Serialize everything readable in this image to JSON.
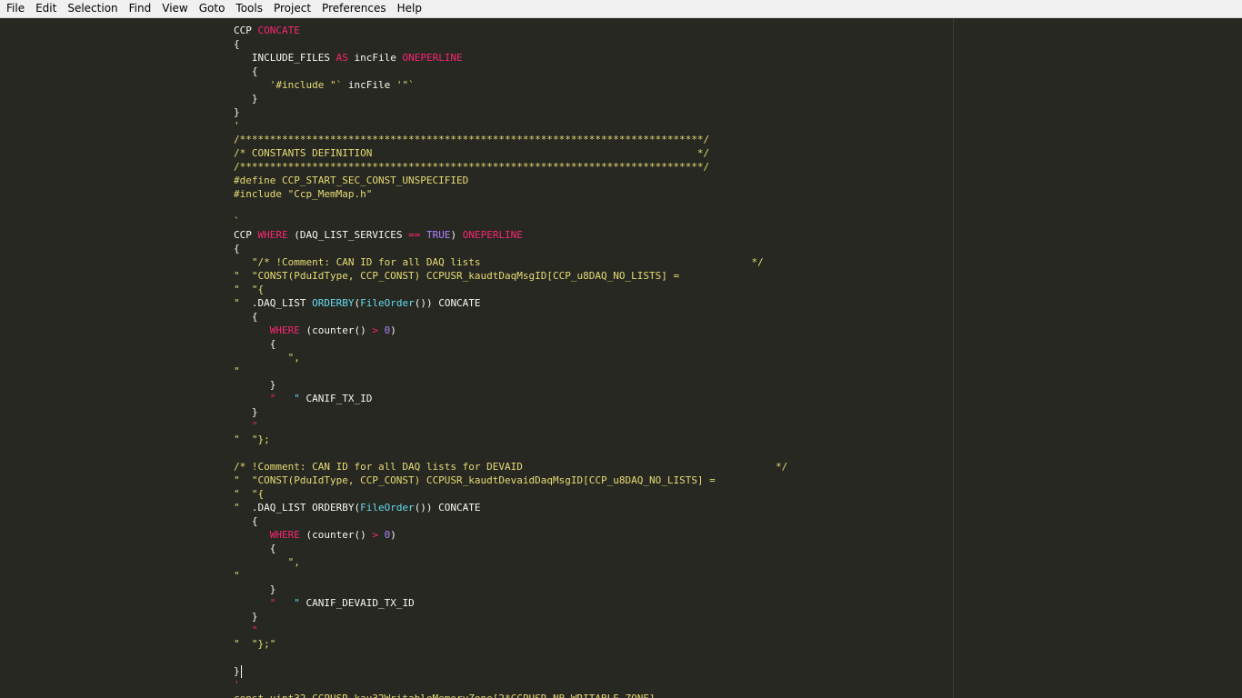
{
  "menu": [
    "File",
    "Edit",
    "Selection",
    "Find",
    "View",
    "Goto",
    "Tools",
    "Project",
    "Preferences",
    "Help"
  ],
  "colors": {
    "background": "#272822",
    "text": "#f8f8f2",
    "keyword": "#f92672",
    "string": "#e6db74",
    "function": "#66d9ef",
    "constant": "#ae81ff",
    "ruler": "#3e3d32"
  },
  "lines": [
    [
      [
        "t",
        "CCP "
      ],
      [
        "k",
        "CONCATE"
      ]
    ],
    [
      [
        "t",
        "{"
      ]
    ],
    [
      [
        "t",
        "   INCLUDE_FILES "
      ],
      [
        "k",
        "AS"
      ],
      [
        "t",
        " incFile "
      ],
      [
        "k",
        "ONEPERLINE"
      ]
    ],
    [
      [
        "t",
        "   {"
      ]
    ],
    [
      [
        "t",
        "      "
      ],
      [
        "s",
        "'#include \"`"
      ],
      [
        "t",
        " incFile "
      ],
      [
        "s",
        "'\"`"
      ]
    ],
    [
      [
        "t",
        "   }"
      ]
    ],
    [
      [
        "t",
        "}"
      ]
    ],
    [
      [
        "s",
        "'"
      ]
    ],
    [
      [
        "s",
        "/*****************************************************************************/"
      ]
    ],
    [
      [
        "s",
        "/* CONSTANTS DEFINITION                                                      */"
      ]
    ],
    [
      [
        "s",
        "/*****************************************************************************/"
      ]
    ],
    [
      [
        "s",
        "#define CCP_START_SEC_CONST_UNSPECIFIED"
      ]
    ],
    [
      [
        "s",
        "#include \"Ccp_MemMap.h\""
      ]
    ],
    [
      [
        "t",
        ""
      ]
    ],
    [
      [
        "s",
        "`"
      ]
    ],
    [
      [
        "t",
        "CCP "
      ],
      [
        "k",
        "WHERE"
      ],
      [
        "t",
        " (DAQ_LIST_SERVICES "
      ],
      [
        "k",
        "=="
      ],
      [
        "t",
        " "
      ],
      [
        "c",
        "TRUE"
      ],
      [
        "t",
        ") "
      ],
      [
        "k",
        "ONEPERLINE"
      ]
    ],
    [
      [
        "t",
        "{"
      ]
    ],
    [
      [
        "t",
        "   "
      ],
      [
        "s",
        "\"/* !Comment: CAN ID for all DAQ lists                                             */"
      ]
    ],
    [
      [
        "s",
        "\"  \"CONST(PduIdType, CCP_CONST) CCPUSR_kaudtDaqMsgID[CCP_u8DAQ_NO_LISTS] ="
      ]
    ],
    [
      [
        "s",
        "\"  \"{"
      ]
    ],
    [
      [
        "s",
        "\""
      ],
      [
        "t",
        "  .DAQ_LIST "
      ],
      [
        "f",
        "ORDERBY"
      ],
      [
        "t",
        "("
      ],
      [
        "f",
        "FileOrder"
      ],
      [
        "t",
        "()) CONCATE"
      ]
    ],
    [
      [
        "t",
        "   {"
      ]
    ],
    [
      [
        "t",
        "      "
      ],
      [
        "k",
        "WHERE"
      ],
      [
        "t",
        " (counter() "
      ],
      [
        "k",
        ">"
      ],
      [
        "t",
        " "
      ],
      [
        "c",
        "0"
      ],
      [
        "t",
        ")"
      ]
    ],
    [
      [
        "t",
        "      {"
      ]
    ],
    [
      [
        "t",
        "         "
      ],
      [
        "s",
        "\","
      ]
    ],
    [
      [
        "s",
        "\""
      ]
    ],
    [
      [
        "t",
        "      }"
      ]
    ],
    [
      [
        "t",
        "      "
      ],
      [
        "k",
        "\""
      ],
      [
        "t",
        "   "
      ],
      [
        "f",
        "\""
      ],
      [
        "t",
        " CANIF_TX_ID"
      ]
    ],
    [
      [
        "t",
        "   }"
      ]
    ],
    [
      [
        "t",
        "   "
      ],
      [
        "k",
        "\""
      ]
    ],
    [
      [
        "s",
        "\"  \"};"
      ]
    ],
    [
      [
        "t",
        ""
      ]
    ],
    [
      [
        "s",
        "/* !Comment: CAN ID for all DAQ lists for DEVAID                                          */"
      ]
    ],
    [
      [
        "s",
        "\"  \"CONST(PduIdType, CCP_CONST) CCPUSR_kaudtDevaidDaqMsgID[CCP_u8DAQ_NO_LISTS] ="
      ]
    ],
    [
      [
        "s",
        "\"  \"{"
      ]
    ],
    [
      [
        "s",
        "\""
      ],
      [
        "t",
        "  .DAQ_LIST ORDERBY("
      ],
      [
        "f",
        "FileOrder"
      ],
      [
        "t",
        "()) CONCATE"
      ]
    ],
    [
      [
        "t",
        "   {"
      ]
    ],
    [
      [
        "t",
        "      "
      ],
      [
        "k",
        "WHERE"
      ],
      [
        "t",
        " (counter() "
      ],
      [
        "k",
        ">"
      ],
      [
        "t",
        " "
      ],
      [
        "c",
        "0"
      ],
      [
        "t",
        ")"
      ]
    ],
    [
      [
        "t",
        "      {"
      ]
    ],
    [
      [
        "t",
        "         "
      ],
      [
        "s",
        "\","
      ]
    ],
    [
      [
        "s",
        "\""
      ]
    ],
    [
      [
        "t",
        "      }"
      ]
    ],
    [
      [
        "t",
        "      "
      ],
      [
        "k",
        "\""
      ],
      [
        "t",
        "   "
      ],
      [
        "f",
        "\""
      ],
      [
        "t",
        " CANIF_DEVAID_TX_ID"
      ]
    ],
    [
      [
        "t",
        "   }"
      ]
    ],
    [
      [
        "t",
        "   "
      ],
      [
        "k",
        "\""
      ]
    ],
    [
      [
        "s",
        "\"  \"};\""
      ]
    ],
    [
      [
        "t",
        ""
      ]
    ],
    [
      [
        "t",
        "}"
      ]
    ],
    [
      [
        "k",
        "'"
      ]
    ],
    [
      [
        "s",
        "const uint32 CCPUSR_kau32WritableMemoryZone[2*CCPUSR_NB_WRITABLE_ZONE]"
      ]
    ]
  ],
  "cursor_line": 47
}
